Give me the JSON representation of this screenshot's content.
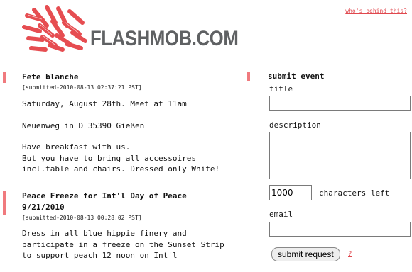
{
  "site": {
    "title": "FLASHMOB.COM",
    "about_link": "who's behind this?",
    "brand_color": "#e0484e"
  },
  "posts": [
    {
      "title": "Fete blanche",
      "meta": "[submitted-2010-08-13 02:37:21 PST]",
      "body": [
        "Saturday, August 28th. Meet at 11am",
        "Neuenweg in D 35390 Gießen",
        "Have breakfast with us.\nBut you have to bring all accessoires incl.table and chairs. Dressed only White!"
      ]
    },
    {
      "title": "Peace Freeze for Int'l Day of Peace 9/21/2010",
      "meta": "[submitted-2010-08-13 00:28:02 PST]",
      "body": [
        "Dress in all blue hippie finery and participate in a freeze on the Sunset Strip to support peach 12 noon on Int'l"
      ]
    }
  ],
  "form": {
    "heading": "submit event",
    "title_label": "title",
    "title_value": "",
    "description_label": "description",
    "description_value": "",
    "char_count": "1000",
    "chars_left_label": "characters left",
    "email_label": "email",
    "email_value": "",
    "submit_label": "submit request",
    "help_label": "?"
  }
}
